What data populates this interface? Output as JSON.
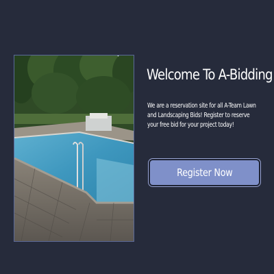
{
  "hero": {
    "title": "Welcome To A-Bidding",
    "description": "We are a reservation site for all A-Team Lawn and Landscaping Bids! Register to reserve your free bid for your project today!",
    "register_label": "Register Now"
  },
  "image": {
    "subject": "pool-photo"
  },
  "colors": {
    "background": "#262b3b",
    "button": "#7f90c9",
    "text": "#ffffff"
  }
}
